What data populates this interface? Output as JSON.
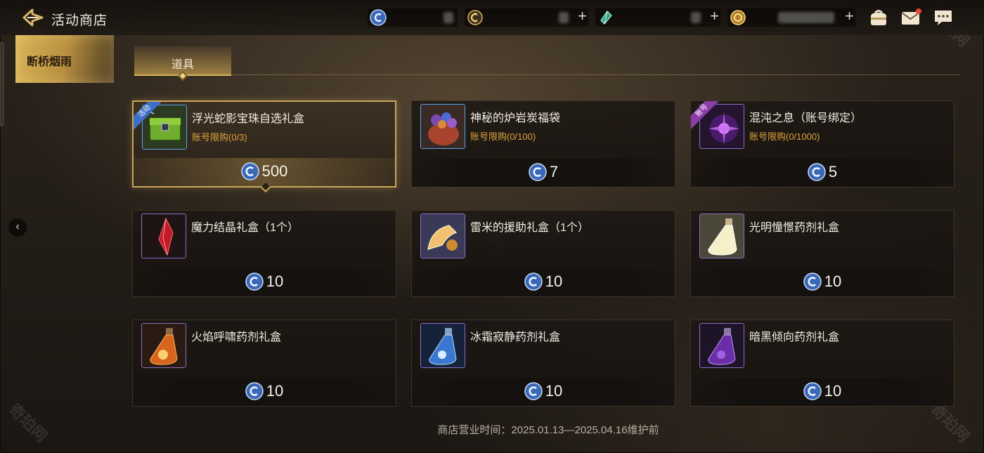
{
  "header": {
    "title": "活动商店",
    "currencies": [
      {
        "icon": "spiral-coin-icon",
        "value": "",
        "has_plus": false
      },
      {
        "icon": "c-coin-icon",
        "value": "",
        "has_plus": true
      },
      {
        "icon": "green-crystal-icon",
        "value": "",
        "has_plus": true
      },
      {
        "icon": "gold-coin-icon",
        "value": "",
        "has_plus": true
      }
    ],
    "plus_label": "+"
  },
  "sidebar": {
    "active_tab": "断桥烟雨",
    "collapse_label": "‹"
  },
  "category": {
    "active_tab": "道具"
  },
  "items": [
    {
      "name": "浮光蛇影宝珠自选礼盒",
      "limit": "账号限购(0/3)",
      "price": "500",
      "tag": "活动",
      "selected": true
    },
    {
      "name": "神秘的炉岩炭福袋",
      "limit": "账号限购(0/100)",
      "price": "7",
      "tag": "",
      "selected": false
    },
    {
      "name": "混沌之息（账号绑定）",
      "limit": "账号限购(0/1000)",
      "price": "5",
      "tag": "账号",
      "selected": false
    },
    {
      "name": "魔力结晶礼盒（1个）",
      "limit": "",
      "price": "10",
      "tag": "",
      "selected": false
    },
    {
      "name": "雷米的援助礼盒（1个）",
      "limit": "",
      "price": "10",
      "tag": "",
      "selected": false
    },
    {
      "name": "光明憧憬药剂礼盒",
      "limit": "",
      "price": "10",
      "tag": "",
      "selected": false
    },
    {
      "name": "火焰呼啸药剂礼盒",
      "limit": "",
      "price": "10",
      "tag": "",
      "selected": false
    },
    {
      "name": "冰霜寂静药剂礼盒",
      "limit": "",
      "price": "10",
      "tag": "",
      "selected": false
    },
    {
      "name": "暗黑倾向药剂礼盒",
      "limit": "",
      "price": "10",
      "tag": "",
      "selected": false
    }
  ],
  "footer": {
    "hours": "商店营业时间：2025.01.13—2025.04.16维护前"
  },
  "watermark": "奇珀网",
  "colors": {
    "accent_gold": "#c9a55a",
    "limit_orange": "#e0a43c",
    "notification_red": "#e8453a"
  }
}
